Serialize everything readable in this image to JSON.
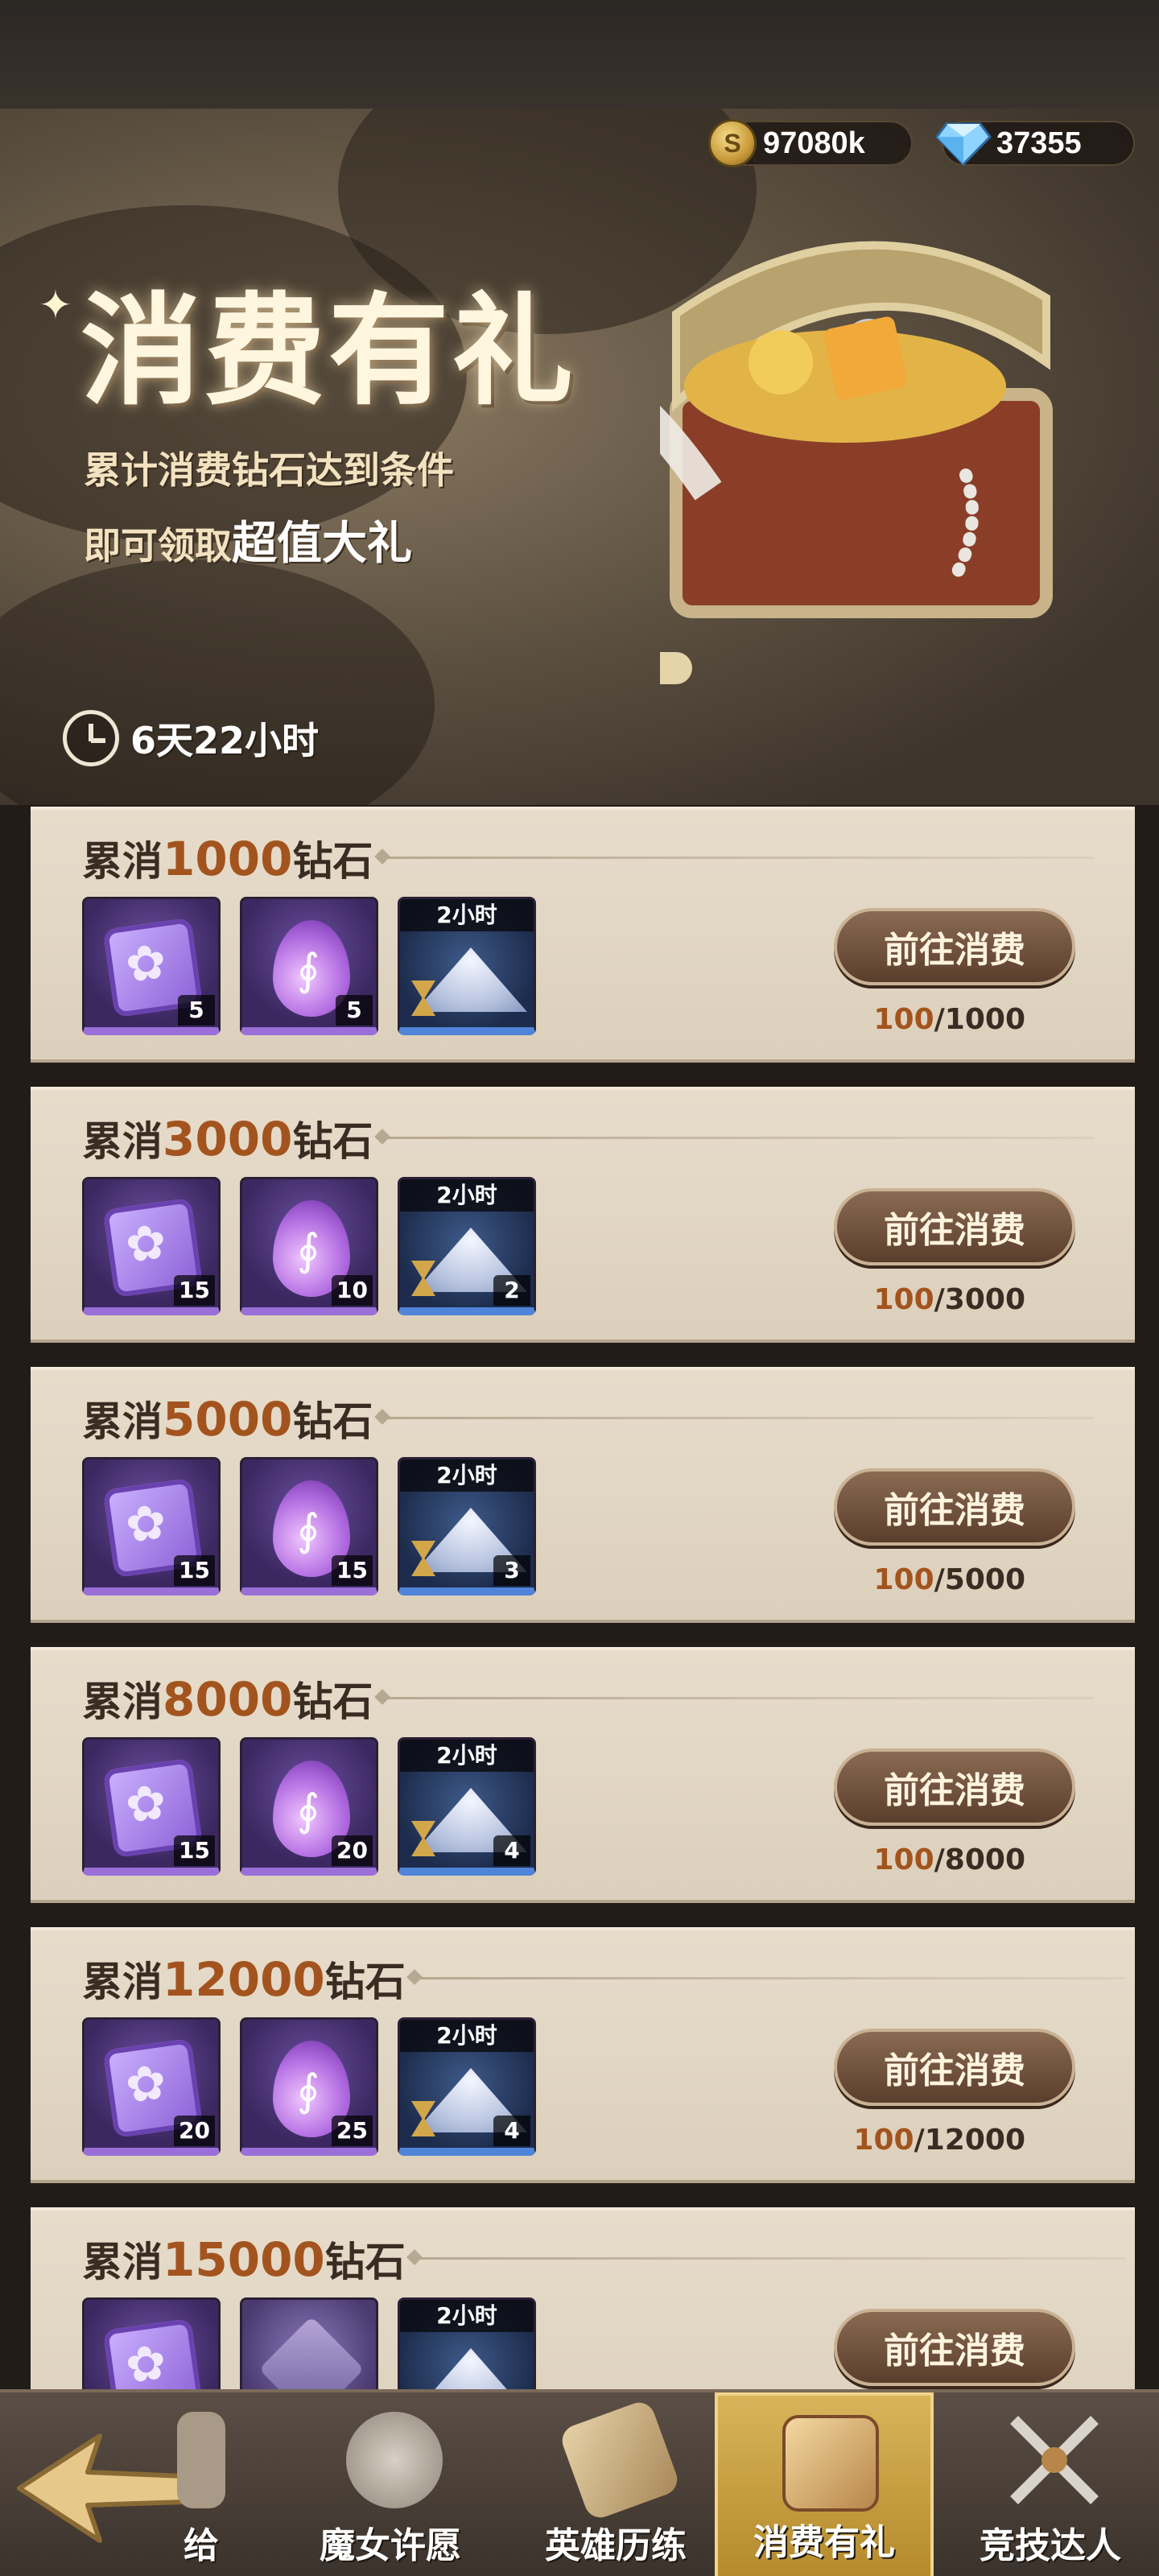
{
  "currency": {
    "gold": "97080k",
    "gold_icon_glyph": "S",
    "gems": "37355"
  },
  "banner": {
    "title": "消费有礼",
    "subtitle_line1": "累计消费钻石达到条件",
    "subtitle_line2_prefix": "即可领取",
    "subtitle_line2_highlight": "超值大礼",
    "timer": "6天22小时"
  },
  "tiers": [
    {
      "title_prefix": "累消",
      "amount": "1000",
      "title_suffix": "钻石",
      "items": [
        {
          "icon": "purple-scroll-icon",
          "count": "5"
        },
        {
          "icon": "purple-essence-icon",
          "count": "5"
        },
        {
          "icon": "hourglass-sand-icon",
          "tag": "2小时",
          "count": ""
        }
      ],
      "button": "前往消费",
      "progress_current": "100",
      "progress_total": "/1000"
    },
    {
      "title_prefix": "累消",
      "amount": "3000",
      "title_suffix": "钻石",
      "items": [
        {
          "icon": "purple-scroll-icon",
          "count": "15"
        },
        {
          "icon": "purple-essence-icon",
          "count": "10"
        },
        {
          "icon": "hourglass-sand-icon",
          "tag": "2小时",
          "count": "2"
        }
      ],
      "button": "前往消费",
      "progress_current": "100",
      "progress_total": "/3000"
    },
    {
      "title_prefix": "累消",
      "amount": "5000",
      "title_suffix": "钻石",
      "items": [
        {
          "icon": "purple-scroll-icon",
          "count": "15"
        },
        {
          "icon": "purple-essence-icon",
          "count": "15"
        },
        {
          "icon": "hourglass-sand-icon",
          "tag": "2小时",
          "count": "3"
        }
      ],
      "button": "前往消费",
      "progress_current": "100",
      "progress_total": "/5000"
    },
    {
      "title_prefix": "累消",
      "amount": "8000",
      "title_suffix": "钻石",
      "items": [
        {
          "icon": "purple-scroll-icon",
          "count": "15"
        },
        {
          "icon": "purple-essence-icon",
          "count": "20"
        },
        {
          "icon": "hourglass-sand-icon",
          "tag": "2小时",
          "count": "4"
        }
      ],
      "button": "前往消费",
      "progress_current": "100",
      "progress_total": "/8000"
    },
    {
      "title_prefix": "累消",
      "amount": "12000",
      "title_suffix": "钻石",
      "items": [
        {
          "icon": "purple-scroll-icon",
          "count": "20"
        },
        {
          "icon": "purple-essence-icon",
          "count": "25"
        },
        {
          "icon": "hourglass-sand-icon",
          "tag": "2小时",
          "count": "4"
        }
      ],
      "button": "前往消费",
      "progress_current": "100",
      "progress_total": "/12000"
    },
    {
      "title_prefix": "累消",
      "amount": "15000",
      "title_suffix": "钻石",
      "items": [
        {
          "icon": "purple-scroll-icon",
          "count": ""
        },
        {
          "icon": "rune-stone-icon",
          "count": ""
        },
        {
          "icon": "hourglass-sand-icon",
          "tag": "2小时",
          "count": ""
        }
      ],
      "button": "前往消费",
      "progress_current": "",
      "progress_total": ""
    }
  ],
  "nav": {
    "back_icon": "back-arrow-icon",
    "tabs": [
      {
        "label": "给",
        "icon": "gift-statue-icon"
      },
      {
        "label": "魔女许愿",
        "icon": "wish-bag-icon"
      },
      {
        "label": "英雄历练",
        "icon": "scroll-map-icon"
      },
      {
        "label": "消费有礼",
        "icon": "gift-box-icon",
        "active": true
      },
      {
        "label": "竞技达人",
        "icon": "crossed-swords-icon"
      }
    ]
  },
  "colors": {
    "highlight": "#a3541e",
    "active_tab": "#d9b45a",
    "button": "#6e5040",
    "card_bg": "#e2d6c2"
  }
}
